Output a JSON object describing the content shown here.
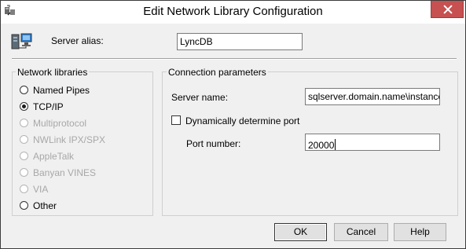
{
  "window": {
    "title": "Edit Network Library Configuration",
    "title_icon": "sql-config-icon",
    "close_icon": "close-icon"
  },
  "alias": {
    "icon": "server-network-icon",
    "label": "Server alias:",
    "value": "LyncDB"
  },
  "network_libraries": {
    "title": "Network libraries",
    "options": [
      {
        "label": "Named Pipes",
        "selected": false,
        "enabled": true
      },
      {
        "label": "TCP/IP",
        "selected": true,
        "enabled": true
      },
      {
        "label": "Multiprotocol",
        "selected": false,
        "enabled": false
      },
      {
        "label": "NWLink IPX/SPX",
        "selected": false,
        "enabled": false
      },
      {
        "label": "AppleTalk",
        "selected": false,
        "enabled": false
      },
      {
        "label": "Banyan VINES",
        "selected": false,
        "enabled": false
      },
      {
        "label": "VIA",
        "selected": false,
        "enabled": false
      },
      {
        "label": "Other",
        "selected": false,
        "enabled": true
      }
    ]
  },
  "connection": {
    "title": "Connection parameters",
    "server_name_label": "Server name:",
    "server_name_value": "sqlserver.domain.name\\instance",
    "dynamic_port_label": "Dynamically determine port",
    "dynamic_port_checked": false,
    "port_label": "Port number:",
    "port_value": "20000"
  },
  "buttons": {
    "ok": "OK",
    "cancel": "Cancel",
    "help": "Help"
  },
  "colors": {
    "close_button": "#c75050",
    "window_bg": "#f0f0f0"
  }
}
